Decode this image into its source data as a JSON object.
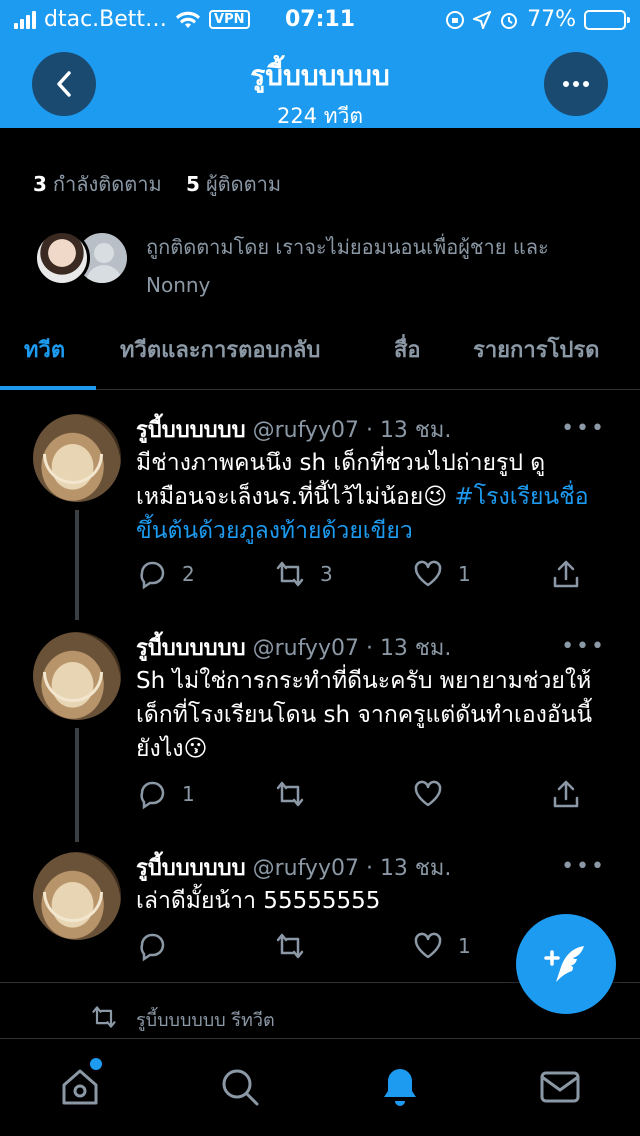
{
  "status_bar": {
    "carrier": "dtac.Bett…",
    "vpn": "VPN",
    "time": "07:11",
    "battery": "77%",
    "battery_level": 0.77
  },
  "header": {
    "title": "รูบี้บบบบบบ",
    "subtitle": "224 ทวีต",
    "accent_color": "#1d9bf0"
  },
  "profile": {
    "following_count": "3",
    "following_label": "กำลังติดตาม",
    "followers_count": "5",
    "followers_label": "ผู้ติดตาม",
    "followed_by_text": "ถูกติดตามโดย เราจะไม่ยอมนอนเพื่อผู้ชาย และ Nonny"
  },
  "tabs": [
    {
      "label": "ทวีต",
      "active": true
    },
    {
      "label": "ทวีตและการตอบกลับ",
      "active": false
    },
    {
      "label": "สื่อ",
      "active": false
    },
    {
      "label": "รายการโปรด",
      "active": false
    }
  ],
  "tweets": [
    {
      "name": "รูบี้บบบบบบ",
      "handle": "@rufyy07 · 13 ชม.",
      "text": "มีช่างภาพคนนึง sh เด็กที่ชวนไปถ่ายรูป ดูเหมือนจะเล็งนร.ที่นี้ไว้ไม่น้อย😉 ",
      "hashtag": "#โรงเรียนชื่อขึ้นต้นด้วยภูลงท้ายด้วยเขียว",
      "replies": "2",
      "retweets": "3",
      "likes": "1"
    },
    {
      "name": "รูบี้บบบบบบ",
      "handle": "@rufyy07 · 13 ชม.",
      "text": "Sh ไม่ใช่การกระทำที่ดีนะครับ พยายามช่วยให้เด็กที่โรงเรียนโดน sh จากครูแต่ดันทำเองอันนี้ยังไง😗",
      "replies": "1",
      "retweets": "",
      "likes": ""
    },
    {
      "name": "รูบี้บบบบบบ",
      "handle": "@rufyy07 · 13 ชม.",
      "text": "เล่าดีมั้ยน้าา 55555555",
      "replies": "",
      "retweets": "",
      "likes": "1"
    }
  ],
  "retweet_notice": "รูบี้บบบบบบ รีทวีต",
  "more_dots": "•••",
  "icons": {
    "back": "chevron-left-icon",
    "more": "ellipsis-icon",
    "compose": "feather-plus-icon",
    "home": "home-icon",
    "search": "search-icon",
    "notifications": "bell-icon",
    "messages": "mail-icon"
  }
}
